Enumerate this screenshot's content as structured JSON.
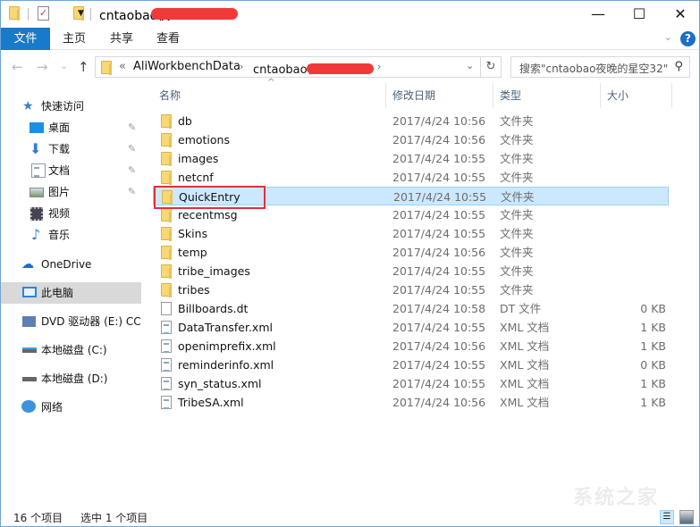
{
  "titlebar": {
    "title": "cntaobao夜",
    "minimize": "—",
    "maximize": "☐",
    "close": "✕",
    "quick_access_icons": [
      "folder-icon",
      "properties-check-icon",
      "new-folder-icon",
      "customize-dropdown-icon"
    ]
  },
  "ribbon": {
    "tabs": [
      {
        "label": "文件",
        "active": true
      },
      {
        "label": "主页"
      },
      {
        "label": "共享"
      },
      {
        "label": "查看"
      }
    ],
    "expand": "⌄",
    "help": "?"
  },
  "navigation": {
    "back": "←",
    "forward": "→",
    "recent": "⌄",
    "up": "↑",
    "overflow": "«",
    "breadcrumbs": [
      "AliWorkbenchData",
      "cntaobao夜"
    ],
    "crumb_sep": "›",
    "dropdown": "⌄",
    "refresh": "↻",
    "search_placeholder": "搜索\"cntaobao夜晚的星空32\"",
    "search_icon": "⚲"
  },
  "sidebar": {
    "quick_access": {
      "label": "快速访问",
      "icon": "star-icon"
    },
    "items": [
      {
        "label": "桌面",
        "icon": "desktop-icon",
        "pinned": true
      },
      {
        "label": "下载",
        "icon": "download-icon",
        "pinned": true
      },
      {
        "label": "文档",
        "icon": "documents-icon",
        "pinned": true
      },
      {
        "label": "图片",
        "icon": "pictures-icon",
        "pinned": true
      },
      {
        "label": "视频",
        "icon": "videos-icon",
        "pinned": false
      },
      {
        "label": "音乐",
        "icon": "music-icon",
        "pinned": false
      }
    ],
    "onedrive": "OneDrive",
    "this_pc": "此电脑",
    "drives": [
      {
        "label": "DVD 驱动器 (E:) CCS",
        "icon": "dvd-drive-icon"
      },
      {
        "label": "本地磁盘 (C:)",
        "icon": "system-drive-icon"
      },
      {
        "label": "本地磁盘 (D:)",
        "icon": "drive-icon"
      }
    ],
    "network": "网络",
    "pin_glyph": "📌"
  },
  "list": {
    "columns": {
      "name": "名称",
      "date": "修改日期",
      "type": "类型",
      "size": "大小"
    },
    "sort_caret": "^",
    "rows": [
      {
        "name": "db",
        "date": "2017/4/24 10:56",
        "type": "文件夹",
        "size": "",
        "kind": "folder"
      },
      {
        "name": "emotions",
        "date": "2017/4/24 10:56",
        "type": "文件夹",
        "size": "",
        "kind": "folder"
      },
      {
        "name": "images",
        "date": "2017/4/24 10:55",
        "type": "文件夹",
        "size": "",
        "kind": "folder"
      },
      {
        "name": "netcnf",
        "date": "2017/4/24 10:55",
        "type": "文件夹",
        "size": "",
        "kind": "folder"
      },
      {
        "name": "QuickEntry",
        "date": "2017/4/24 10:55",
        "type": "文件夹",
        "size": "",
        "kind": "folder",
        "selected": true
      },
      {
        "name": "recentmsg",
        "date": "2017/4/24 10:55",
        "type": "文件夹",
        "size": "",
        "kind": "folder"
      },
      {
        "name": "Skins",
        "date": "2017/4/24 10:55",
        "type": "文件夹",
        "size": "",
        "kind": "folder"
      },
      {
        "name": "temp",
        "date": "2017/4/24 10:56",
        "type": "文件夹",
        "size": "",
        "kind": "folder"
      },
      {
        "name": "tribe_images",
        "date": "2017/4/24 10:55",
        "type": "文件夹",
        "size": "",
        "kind": "folder"
      },
      {
        "name": "tribes",
        "date": "2017/4/24 10:55",
        "type": "文件夹",
        "size": "",
        "kind": "folder"
      },
      {
        "name": "Billboards.dt",
        "date": "2017/4/24 10:58",
        "type": "DT 文件",
        "size": "0 KB",
        "kind": "file"
      },
      {
        "name": "DataTransfer.xml",
        "date": "2017/4/24 10:55",
        "type": "XML 文档",
        "size": "1 KB",
        "kind": "xml"
      },
      {
        "name": "openimprefix.xml",
        "date": "2017/4/24 10:56",
        "type": "XML 文档",
        "size": "1 KB",
        "kind": "xml"
      },
      {
        "name": "reminderinfo.xml",
        "date": "2017/4/24 10:55",
        "type": "XML 文档",
        "size": "0 KB",
        "kind": "xml"
      },
      {
        "name": "syn_status.xml",
        "date": "2017/4/24 10:55",
        "type": "XML 文档",
        "size": "1 KB",
        "kind": "xml"
      },
      {
        "name": "TribeSA.xml",
        "date": "2017/4/24 10:56",
        "type": "XML 文档",
        "size": "1 KB",
        "kind": "xml"
      }
    ]
  },
  "status": {
    "count": "16 个项目",
    "selection": "选中 1 个项目"
  },
  "watermark": "系统之家",
  "colors": {
    "accent": "#1979ca",
    "selection_bg": "#cce8ff",
    "selection_border": "#99d1ff",
    "highlight_box": "#e0303c",
    "folder": "#f8d775"
  }
}
